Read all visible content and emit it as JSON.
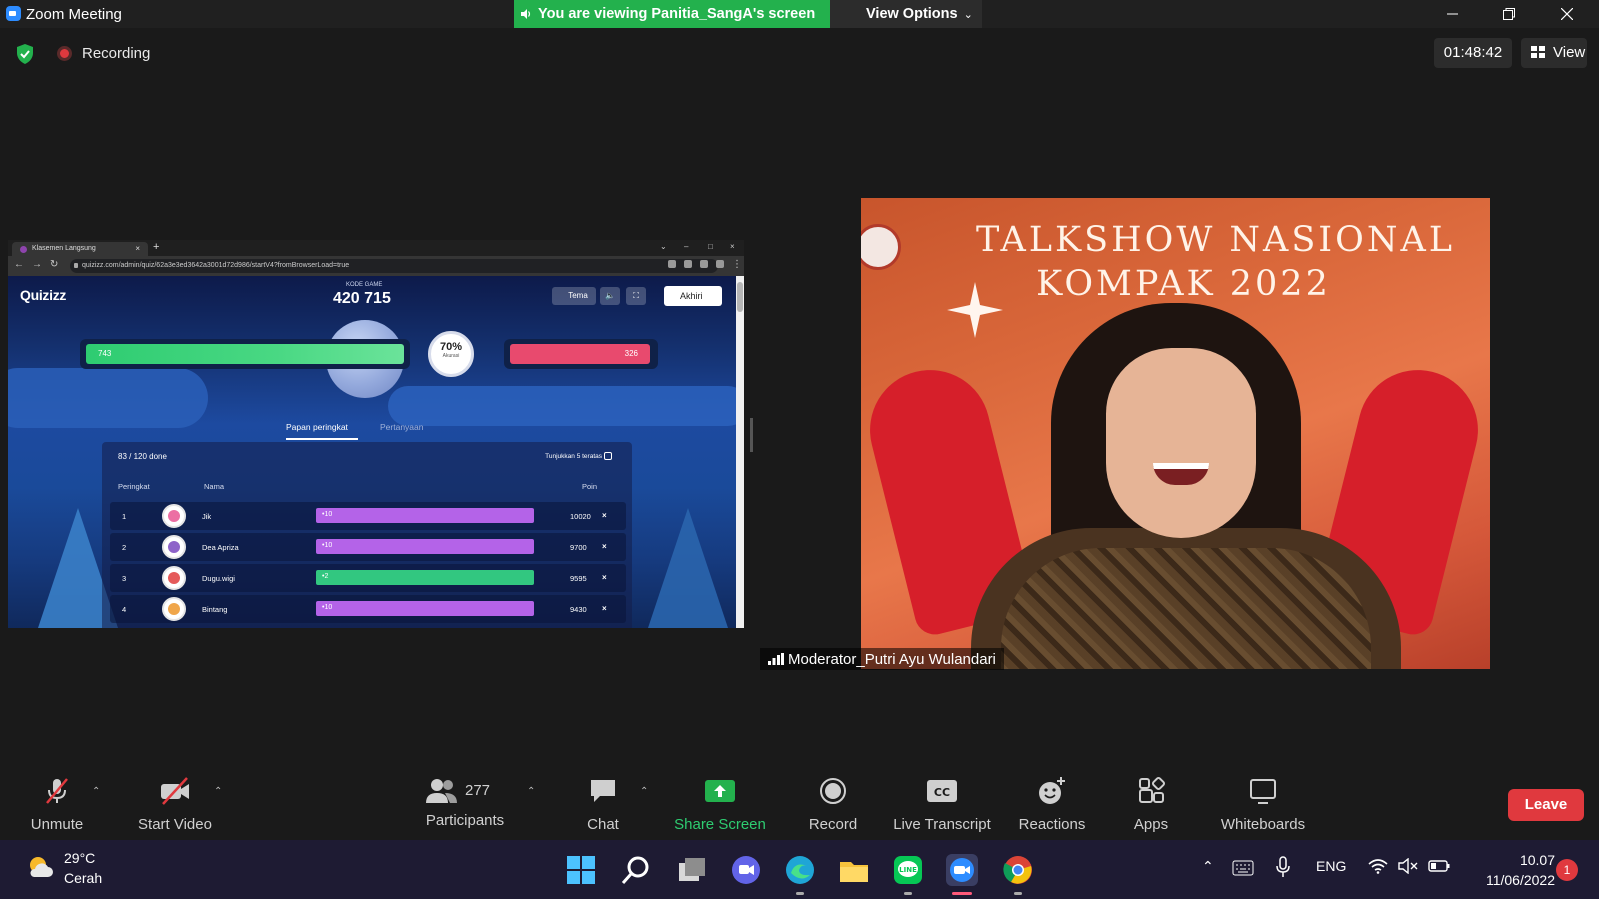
{
  "window": {
    "title": "Zoom Meeting",
    "share_banner": "You are viewing Panitia_SangA's screen",
    "view_options": "View Options"
  },
  "status": {
    "recording_label": "Recording",
    "timer": "01:48:42",
    "view_label": "View"
  },
  "shared_screen": {
    "browser": {
      "tab_title": "Klasemen Langsung",
      "url": "quizizz.com/admin/quiz/62a3e3ed3642a3001d72d986/startV4?fromBrowserLoad=true"
    },
    "quiz": {
      "logo": "Quizizz",
      "game_code_label": "KODE GAME",
      "game_code": "420 715",
      "theme_button": "Tema",
      "end_button": "Akhiri",
      "correct_count": "743",
      "wrong_count": "326",
      "accuracy_value": "70%",
      "accuracy_label": "Akurasi",
      "tabs": [
        "Papan peringkat",
        "Pertanyaan"
      ],
      "progress": "83 / 120 done",
      "top5_label": "Tunjukkan 5 teratas",
      "headers": {
        "rank": "Peringkat",
        "name": "Nama",
        "points": "Poin"
      },
      "rows": [
        {
          "rank": "1",
          "name": "Jik",
          "streak": "10",
          "points": "10020",
          "bar_color": "#b463e8",
          "avatar": "#ec6fa3"
        },
        {
          "rank": "2",
          "name": "Dea Apriza",
          "streak": "10",
          "points": "9700",
          "bar_color": "#b463e8",
          "avatar": "#8e63c9"
        },
        {
          "rank": "3",
          "name": "Dugu.wigi",
          "streak": "2",
          "points": "9595",
          "bar_color": "#32c780",
          "avatar": "#e55a5a"
        },
        {
          "rank": "4",
          "name": "Bintang",
          "streak": "10",
          "points": "9430",
          "bar_color": "#b463e8",
          "avatar": "#f0a64a"
        }
      ]
    }
  },
  "video": {
    "headline_line1": "TALKSHOW NASIONAL",
    "headline_line2": "KOMPAK 2022",
    "participant_name": "Moderator_Putri Ayu Wulandari"
  },
  "toolbar": {
    "unmute": "Unmute",
    "start_video": "Start Video",
    "participants": "Participants",
    "participant_count": "277",
    "chat": "Chat",
    "share_screen": "Share Screen",
    "record": "Record",
    "live_transcript": "Live Transcript",
    "reactions": "Reactions",
    "apps": "Apps",
    "whiteboards": "Whiteboards",
    "leave": "Leave"
  },
  "taskbar": {
    "temperature": "29°C",
    "weather": "Cerah",
    "language": "ENG",
    "time": "10.07",
    "date": "11/06/2022",
    "notifications": "1"
  },
  "colors": {
    "zoom_blue": "#2d8cff",
    "share_green": "#23b14d",
    "leave_red": "#e0393e",
    "correct_green": "#2ecc71",
    "wrong_pink": "#e84a6e"
  }
}
